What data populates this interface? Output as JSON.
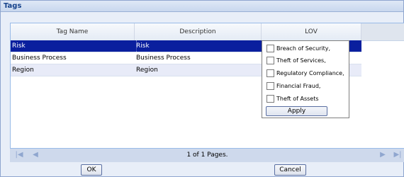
{
  "panel": {
    "title": "Tags"
  },
  "grid": {
    "columns": [
      "Tag Name",
      "Description",
      "LOV"
    ],
    "rows": [
      {
        "name": "Risk",
        "description": "Risk",
        "selected": true
      },
      {
        "name": "Business Process",
        "description": "Business Process",
        "selected": false
      },
      {
        "name": "Region",
        "description": "Region",
        "selected": false
      }
    ]
  },
  "lov_popup": {
    "options": [
      {
        "label": "Breach of Security,",
        "checked": false
      },
      {
        "label": "Theft of Services,",
        "checked": false
      },
      {
        "label": "Regulatory Compliance,",
        "checked": false
      },
      {
        "label": "Financial Fraud,",
        "checked": false
      },
      {
        "label": "Theft of Assets",
        "checked": false
      }
    ],
    "apply_label": "Apply"
  },
  "pager": {
    "text": "1 of 1 Pages."
  },
  "footer": {
    "ok_label": "OK",
    "cancel_label": "Cancel"
  },
  "colors": {
    "selected_row": "#0a1f9e",
    "alt_row": "#e8ebf8",
    "background": "#e8eef8"
  }
}
